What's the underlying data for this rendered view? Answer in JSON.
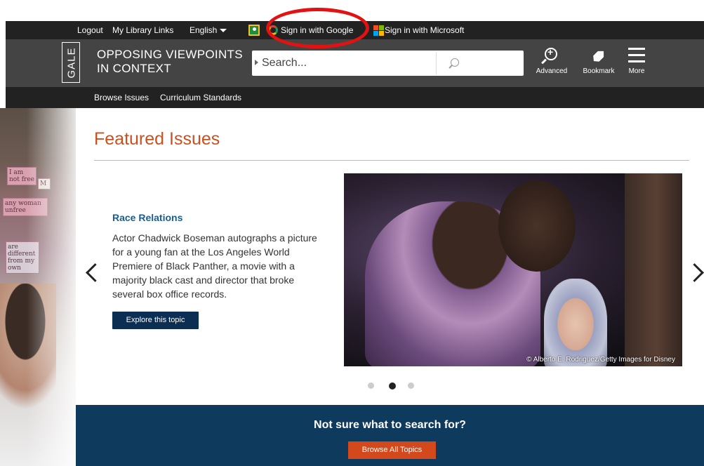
{
  "utility_bar": {
    "logout": "Logout",
    "library_links": "My Library Links",
    "language": "English",
    "google_signin": "Sign in with Google",
    "microsoft_signin": "Sign in with Microsoft"
  },
  "header": {
    "logo": "GALE",
    "product_line1": "OPPOSING VIEWPOINTS",
    "product_line2": "IN CONTEXT",
    "search_placeholder": "Search...",
    "tools": {
      "advanced": "Advanced",
      "bookmark": "Bookmark",
      "more": "More"
    }
  },
  "subnav": {
    "browse_issues": "Browse Issues",
    "curriculum_standards": "Curriculum Standards"
  },
  "featured": {
    "heading": "Featured Issues",
    "topic_title": "Race Relations",
    "topic_description": "Actor Chadwick Boseman autographs a picture for a young fan at the Los Angeles World Premiere of Black Panther, a movie with a majority black cast and director that broke several box office records.",
    "explore_button": "Explore this topic",
    "photo_credit": "© Alberto E. Rodriguez/Getty Images for Disney",
    "carousel_active_index": 2,
    "carousel_total": 3
  },
  "left_photo_signs": {
    "sign1": "I am not free",
    "sign2": "M",
    "sign3": "any woman unfree",
    "sign4": "are different from my own"
  },
  "banner": {
    "title": "Not sure what to search for?",
    "button": "Browse All Topics"
  },
  "colors": {
    "accent_orange": "#c8511f",
    "button_navy": "#0b2e52",
    "banner_navy": "#0e3a5e",
    "annotation_red": "#e31212"
  }
}
